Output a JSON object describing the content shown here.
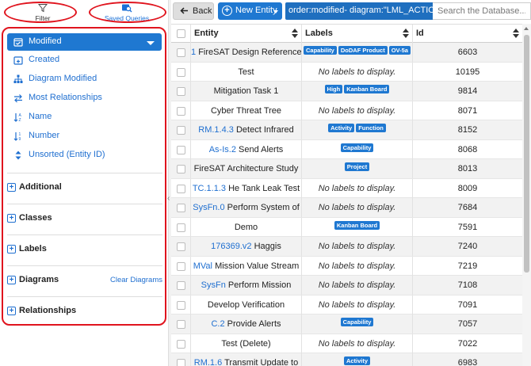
{
  "tabs": {
    "filter": "Filter",
    "saved": "Saved Queries"
  },
  "sort": {
    "active": "Modified",
    "items": [
      "Created",
      "Diagram Modified",
      "Most Relationships",
      "Name",
      "Number",
      "Unsorted (Entity ID)"
    ]
  },
  "sections": [
    {
      "label": "Additional",
      "link": ""
    },
    {
      "label": "Classes",
      "link": ""
    },
    {
      "label": "Labels",
      "link": ""
    },
    {
      "label": "Diagrams",
      "link": "Clear Diagrams"
    },
    {
      "label": "Relationships",
      "link": ""
    }
  ],
  "toolbar": {
    "back": "Back",
    "new_entity": "New Entity",
    "query": "order:modified- diagram:\"LML_ACTION\"",
    "search_placeholder": "Search the Database..."
  },
  "table": {
    "headers": {
      "entity": "Entity",
      "labels": "Labels",
      "id": "Id"
    },
    "no_labels": "No labels to display.",
    "rows": [
      {
        "num": "1",
        "name": "FireSAT Design Reference",
        "labels": [
          "Capability",
          "DoDAF Product",
          "OV-5a"
        ],
        "id": "6603"
      },
      {
        "num": "",
        "name": "Test",
        "labels": [],
        "id": "10195"
      },
      {
        "num": "",
        "name": "Mitigation Task 1",
        "labels": [
          "High",
          "Kanban Board"
        ],
        "id": "9814"
      },
      {
        "num": "",
        "name": "Cyber Threat Tree",
        "labels": [],
        "id": "8071"
      },
      {
        "num": "RM.1.4.3",
        "name": "Detect Infrared",
        "labels": [
          "Activity",
          "Function"
        ],
        "id": "8152"
      },
      {
        "num": "As-Is.2",
        "name": "Send Alerts",
        "labels": [
          "Capability"
        ],
        "id": "8068"
      },
      {
        "num": "",
        "name": "FireSAT Architecture Study",
        "labels": [
          "Project"
        ],
        "id": "8013"
      },
      {
        "num": "TC.1.1.3",
        "name": "He Tank Leak Test",
        "labels": [],
        "id": "8009"
      },
      {
        "num": "SysFn.0",
        "name": "Perform System of",
        "labels": [],
        "id": "7684"
      },
      {
        "num": "",
        "name": "Demo",
        "labels": [
          "Kanban Board"
        ],
        "id": "7591"
      },
      {
        "num": "176369.v2",
        "name": "Haggis",
        "labels": [],
        "id": "7240"
      },
      {
        "num": "MVal",
        "name": "Mission Value Stream",
        "labels": [],
        "id": "7219"
      },
      {
        "num": "SysFn",
        "name": "Perform Mission",
        "labels": [],
        "id": "7108"
      },
      {
        "num": "",
        "name": "Develop Verification",
        "labels": [],
        "id": "7091"
      },
      {
        "num": "C.2",
        "name": "Provide Alerts",
        "labels": [
          "Capability"
        ],
        "id": "7057"
      },
      {
        "num": "",
        "name": "Test (Delete)",
        "labels": [],
        "id": "7022"
      },
      {
        "num": "RM.1.6",
        "name": "Transmit Update to",
        "labels": [
          "Activity"
        ],
        "id": "6983"
      }
    ]
  },
  "colors": {
    "accent": "#1f78d1",
    "highlight_ring": "#e0141e"
  }
}
